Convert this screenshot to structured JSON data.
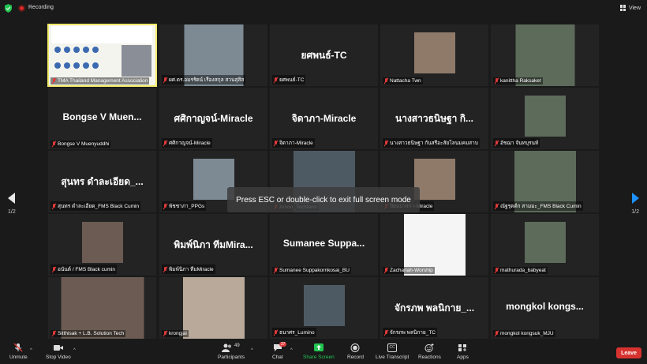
{
  "topbar": {
    "recording_label": "Recording",
    "view_label": "View"
  },
  "tiles": [
    {
      "name": "TMA Thailand Management Association",
      "big": "",
      "kind": "slide"
    },
    {
      "name": "ผศ.ดร.อมรรัตน์ เรืองสกุล สวนสุสิส",
      "big": "",
      "kind": "video"
    },
    {
      "name": "ยศพนธ์-TC",
      "big": "ยศพนธ์-TC",
      "kind": "text"
    },
    {
      "name": "Nattacha Twn",
      "big": "",
      "kind": "video"
    },
    {
      "name": "kanittha Raksaket",
      "big": "",
      "kind": "video"
    },
    {
      "name": "Bongse V Muenyuddhi",
      "big": "Bongse V Muen...",
      "kind": "text"
    },
    {
      "name": "ศศิกาญจน์-Miracle",
      "big": "ศศิกาญจน์-Miracle",
      "kind": "text"
    },
    {
      "name": "จิดาภา-Miracle",
      "big": "จิดาภา-Miracle",
      "kind": "text"
    },
    {
      "name": "นางสาวธนิษฐา กันสรีอะสัยโลนมคมสาบ",
      "big": "นางสาวธนิษฐา กิ...",
      "kind": "text"
    },
    {
      "name": "อัชฌา จันทบุรนท์",
      "big": "",
      "kind": "video"
    },
    {
      "name": "สุนทร ดำละเอียด_FMS Black Cumin",
      "big": "สุนทร ดำละเอียด_...",
      "kind": "text"
    },
    {
      "name": "พัชชาภา_PPGs",
      "big": "",
      "kind": "video"
    },
    {
      "name": "Arnon_Techfarm",
      "big": "",
      "kind": "video"
    },
    {
      "name": "ปิยฉปวรกา-Miracle",
      "big": "",
      "kind": "video"
    },
    {
      "name": "ณัฐรุตต์ก สามมะ_FMS Black Cumin",
      "big": "",
      "kind": "video"
    },
    {
      "name": "อนันต์ / FMS Black cumin",
      "big": "",
      "kind": "video"
    },
    {
      "name": "พิมพ์นิภา ทีมMiracle",
      "big": "พิมพ์นิภา ทีมMira...",
      "kind": "text"
    },
    {
      "name": "Sumanee Suppakornkosai_BU",
      "big": "Sumanee Suppa...",
      "kind": "text"
    },
    {
      "name": "Zachariah-Worship",
      "big": "",
      "kind": "cartoon"
    },
    {
      "name": "mathurada_babyeat",
      "big": "",
      "kind": "video"
    },
    {
      "name": "Sitthisak + L.B. Solution Tech",
      "big": "",
      "kind": "video"
    },
    {
      "name": "krongjai",
      "big": "",
      "kind": "cat"
    },
    {
      "name": "ธนาศร_Lumino",
      "big": "",
      "kind": "video"
    },
    {
      "name": "จักรภพ พลนิกาย_TC",
      "big": "จักรภพ พลนิกาย_...",
      "kind": "text"
    },
    {
      "name": "mongkol kongsuk_MJU",
      "big": "mongkol kongs...",
      "kind": "text"
    }
  ],
  "pager": {
    "left": "1/2",
    "right": "1/2"
  },
  "toast": "Press ESC or double-click to exit full screen mode",
  "toolbar": {
    "unmute": "Unmute",
    "stop_video": "Stop Video",
    "participants": "Participants",
    "participants_count": "49",
    "chat": "Chat",
    "chat_badge": "37",
    "share": "Share Screen",
    "record": "Record",
    "transcript": "Live Transcript",
    "transcript_icon": "CC",
    "reactions": "Reactions",
    "apps": "Apps",
    "leave": "Leave"
  },
  "colors": {
    "leave": "#d6322f",
    "share": "#23c552",
    "active_border": "#f2e96a",
    "mic_off": "#e03a3a"
  }
}
